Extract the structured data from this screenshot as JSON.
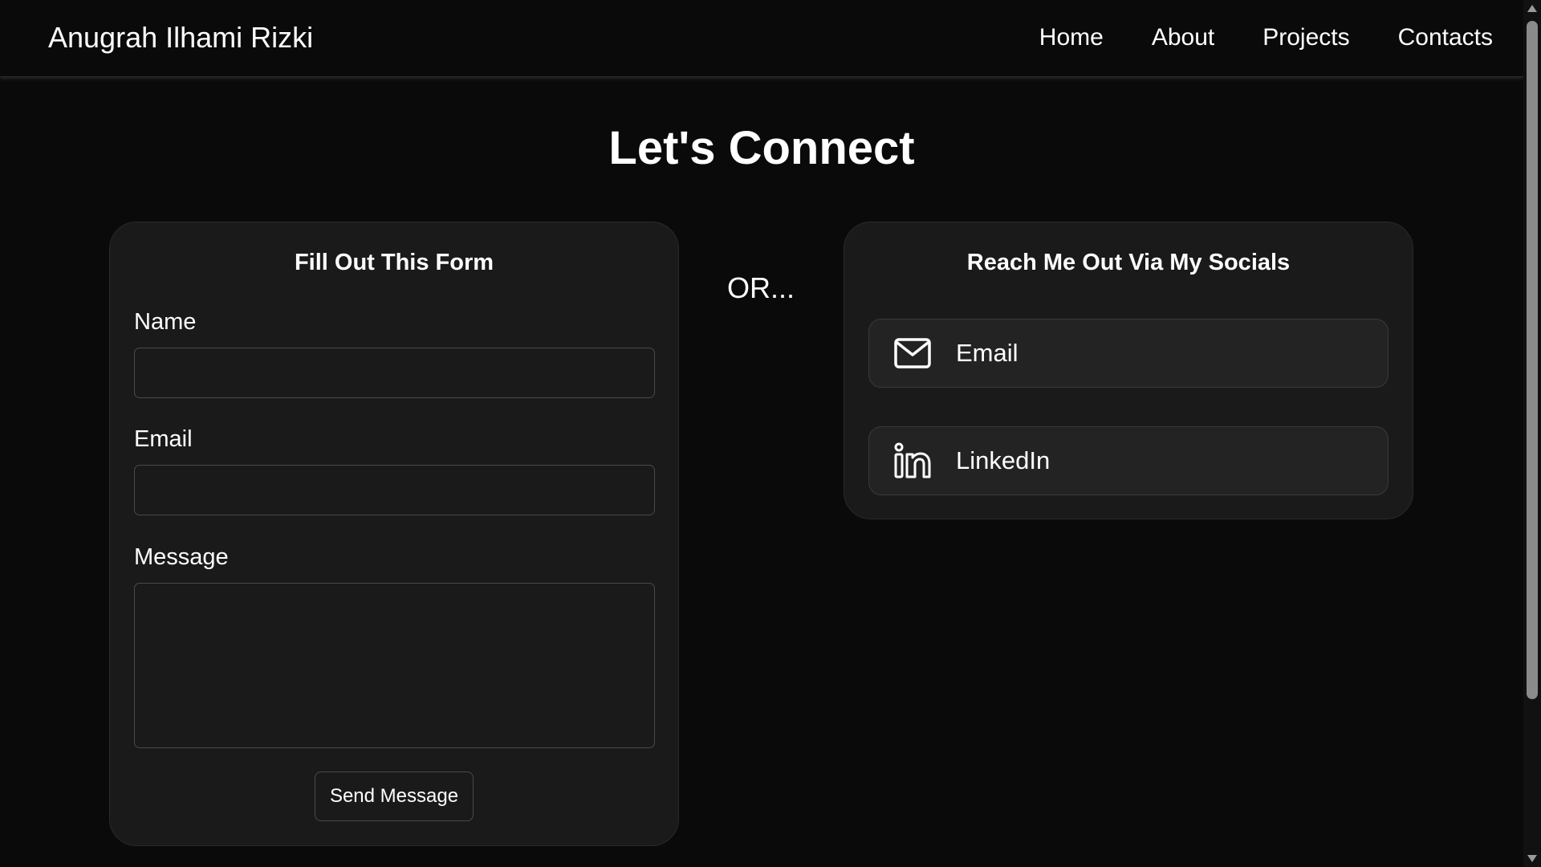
{
  "header": {
    "brand": "Anugrah Ilhami Rizki",
    "nav": [
      {
        "label": "Home"
      },
      {
        "label": "About"
      },
      {
        "label": "Projects"
      },
      {
        "label": "Contacts"
      }
    ]
  },
  "main": {
    "title": "Let's Connect",
    "separator": "OR...",
    "form": {
      "title": "Fill Out This Form",
      "name_label": "Name",
      "name_value": "",
      "email_label": "Email",
      "email_value": "",
      "message_label": "Message",
      "message_value": "",
      "submit_label": "Send Message"
    },
    "socials": {
      "title": "Reach Me Out Via My Socials",
      "links": [
        {
          "label": "Email",
          "icon": "envelope-icon"
        },
        {
          "label": "LinkedIn",
          "icon": "linkedin-icon"
        }
      ]
    }
  },
  "colors": {
    "background": "#0a0a0a",
    "card": "#1a1a1a",
    "social_button": "#232323",
    "text": "#ffffff"
  }
}
